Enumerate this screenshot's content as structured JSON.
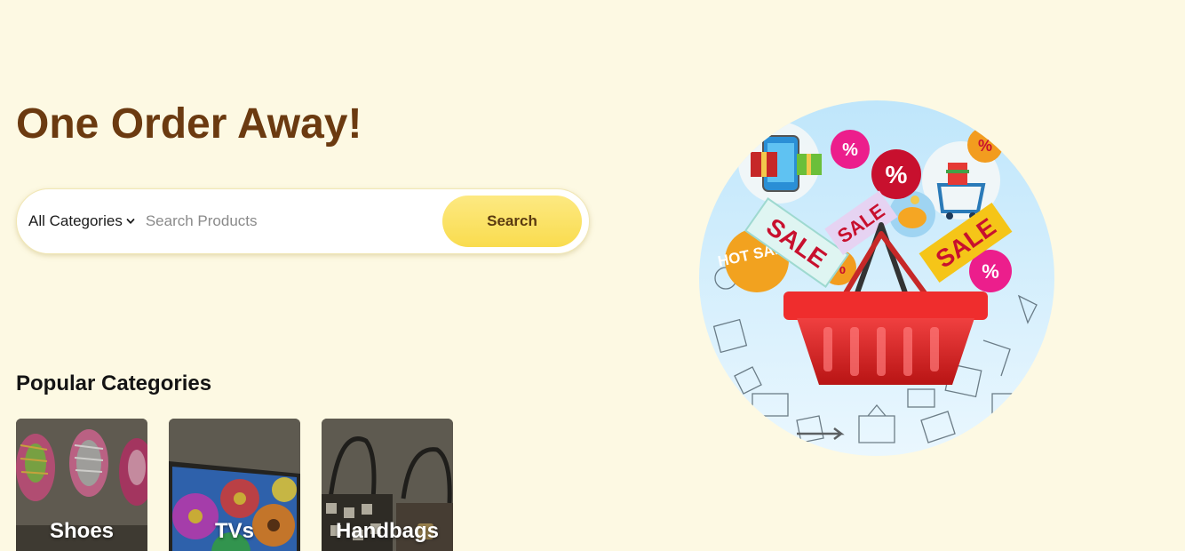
{
  "hero": {
    "title": "One Order Away!"
  },
  "search": {
    "category_label": "All Categories",
    "placeholder": "Search Products",
    "value": "",
    "button_label": "Search"
  },
  "popular": {
    "title": "Popular Categories",
    "items": [
      {
        "label": "Shoes"
      },
      {
        "label": "TVs"
      },
      {
        "label": "Handbags"
      }
    ]
  },
  "illustration": {
    "sale_text": "SALE",
    "hot_sale_text": "HOT SALE",
    "percent_text": "%"
  },
  "colors": {
    "background": "#fdf9e3",
    "title": "#6b3a10",
    "button": "#f9dc4e",
    "basket": "#e02424"
  }
}
